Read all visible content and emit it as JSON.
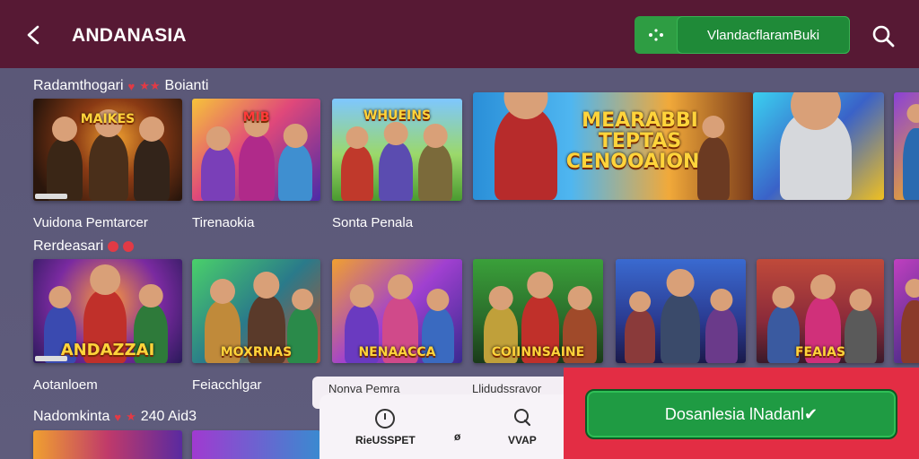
{
  "header": {
    "title": "ANDANASIA",
    "action_button": "VlandacflaramBuki",
    "back_icon": "arrow-left-icon",
    "search_icon": "search-icon"
  },
  "sections": [
    {
      "title": "Radamthogari",
      "rating": "★★",
      "tail": "Boianti",
      "cards": [
        {
          "label": "MAIKES",
          "caption": "Vuidona Pemtarcer"
        },
        {
          "label": "MIB",
          "caption": "Tirenaokia"
        },
        {
          "label": "WHUEINS",
          "caption": "Sonta Penala"
        },
        {
          "label": "MEARABBI TEPTAS CENOOAIONS",
          "caption": ""
        },
        {
          "label": "",
          "caption": ""
        },
        {
          "label": "",
          "caption": ""
        }
      ]
    },
    {
      "title": "Rerdeasari",
      "cards": [
        {
          "label": "ANDAZZAI",
          "caption": "Aotanloem"
        },
        {
          "label": "MOXRNAS",
          "caption": "Feiacchlgar"
        },
        {
          "label": "NENAACCA",
          "caption": "Nonva Pemra"
        },
        {
          "label": "COIINNSAINE",
          "caption": "Llidudssravor"
        },
        {
          "label": "",
          "caption": ""
        },
        {
          "label": "FEAIAS",
          "caption": ""
        },
        {
          "label": "",
          "caption": ""
        }
      ]
    },
    {
      "title": "Nadomkinta",
      "rating": "★",
      "tail": "240 Aid3"
    }
  ],
  "bottom_nav": {
    "item1": "RieUSSPET",
    "item2": "ø",
    "item3": "VVAP"
  },
  "download_button": "Dosanlesia lNadanl✔"
}
